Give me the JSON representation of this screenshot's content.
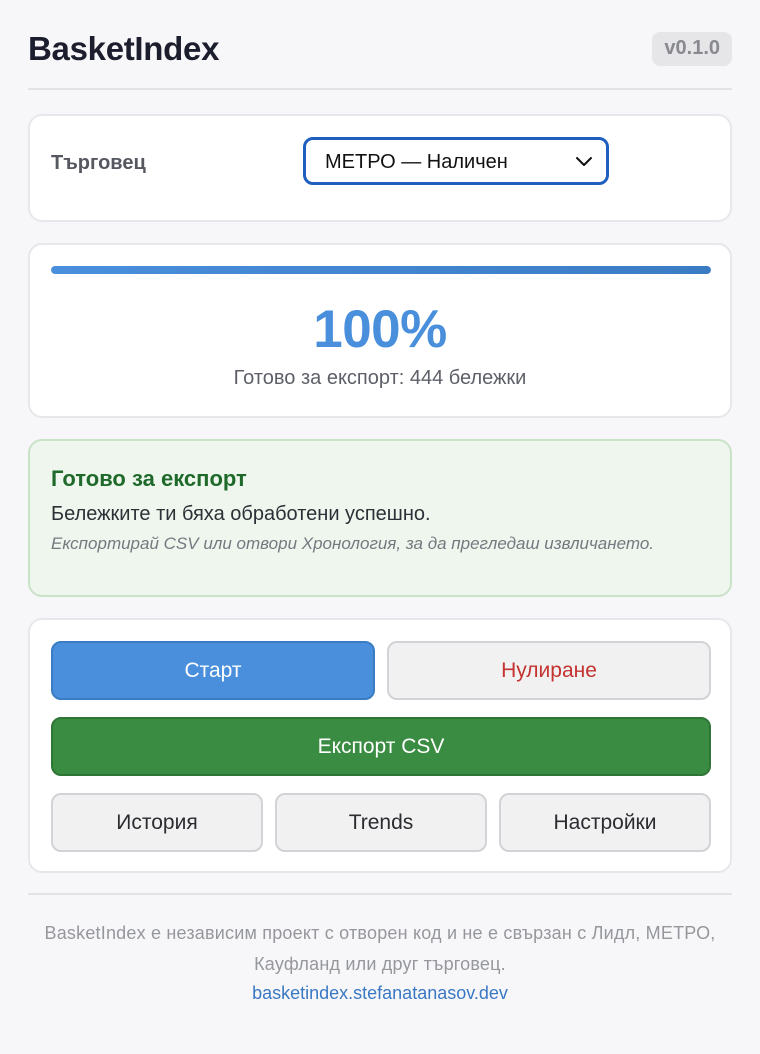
{
  "header": {
    "title": "BasketIndex",
    "version": "v0.1.0"
  },
  "merchant": {
    "label": "Търговец",
    "selected": "МЕТРО — Наличен",
    "icon": "chevron-down-icon"
  },
  "progress": {
    "value": 1.0,
    "percent_label": "100%",
    "status": "Готово за експорт: 444 бележки"
  },
  "success": {
    "title": "Готово за експорт",
    "message": "Бележките ти бяха обработени успешно.",
    "hint": "Експортирай CSV или отвори Хронология, за да прегледаш извличането."
  },
  "actions": {
    "start": "Старт",
    "reset": "Нулиране",
    "export": "Експорт CSV",
    "history": "История",
    "trends": "Trends",
    "settings": "Настройки"
  },
  "footer": {
    "disclaimer": "BasketIndex е независим проект с отворен код и не е свързан с Лидл, МЕТРО, Кауфланд или друг търговец.",
    "link": "basketindex.stefanatanasov.dev"
  },
  "colors": {
    "accent": "#4a8fdc",
    "success": "#3a8c42",
    "danger": "#c4332f",
    "success_bg": "#eef6ee"
  }
}
